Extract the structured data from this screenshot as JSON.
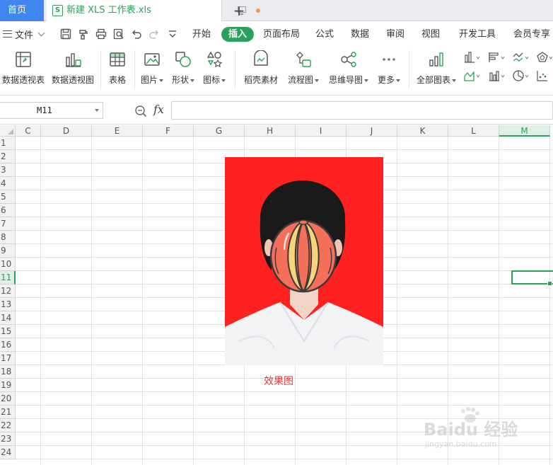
{
  "tabs": {
    "home_label": "首页",
    "doc_title": "新建 XLS 工作表.xls",
    "doc_icon_letter": "S",
    "add_symbol": "+"
  },
  "menu": {
    "file_label": "文件",
    "items": [
      "开始",
      "插入",
      "页面布局",
      "公式",
      "数据",
      "审阅",
      "视图",
      "开发工具",
      "会员专享"
    ],
    "active_index": 1
  },
  "ribbon": {
    "buttons": [
      {
        "label": "数据透视表",
        "dropdown": false
      },
      {
        "label": "数据透视图",
        "dropdown": false
      },
      {
        "label": "表格",
        "dropdown": false
      },
      {
        "label": "图片",
        "dropdown": true
      },
      {
        "label": "形状",
        "dropdown": true
      },
      {
        "label": "图标",
        "dropdown": true
      },
      {
        "label": "稻壳素材",
        "dropdown": false
      },
      {
        "label": "流程图",
        "dropdown": true
      },
      {
        "label": "思维导图",
        "dropdown": true
      },
      {
        "label": "更多",
        "dropdown": true
      },
      {
        "label": "全部图表",
        "dropdown": true
      }
    ]
  },
  "formula_bar": {
    "name_box": "M11",
    "fx_label": "fx",
    "value": ""
  },
  "sheet": {
    "columns": [
      "C",
      "D",
      "E",
      "F",
      "G",
      "H",
      "I",
      "J",
      "K",
      "L",
      "M"
    ],
    "rows": [
      "1",
      "2",
      "3",
      "4",
      "5",
      "6",
      "7",
      "8",
      "9",
      "10",
      "11",
      "12",
      "13",
      "14",
      "15",
      "16",
      "17",
      "18",
      "19",
      "20",
      "21",
      "22",
      "23",
      "24"
    ],
    "selected_column": "M",
    "selected_row": "11",
    "caption": "效果图"
  },
  "watermark": {
    "brand": "Baidu 经验",
    "url": "jingyan.baidu.com"
  },
  "colors": {
    "accent": "#2aa15a",
    "home_tab": "#3f86f0",
    "photo_background": "#ff2020",
    "caption": "#d9353b"
  }
}
